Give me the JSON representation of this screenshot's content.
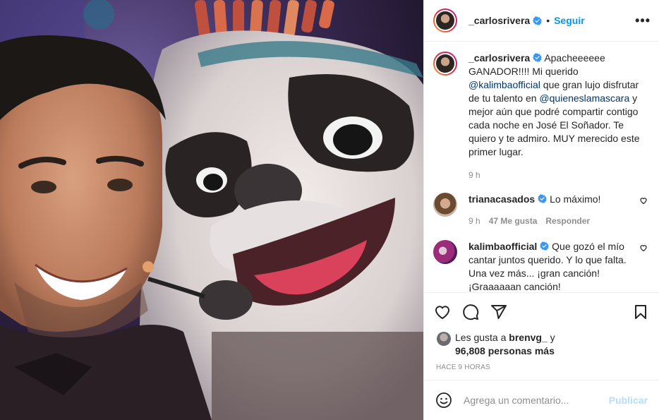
{
  "post": {
    "author": "_carlosrivera",
    "follow_label": "Seguir",
    "separator": "•",
    "caption_prefix": "Apacheeeeee GANADOR!!!! Mi querido ",
    "caption_mention1": "@kalimbaofficial",
    "caption_middle": " que gran lujo disfrutar de tu talento en ",
    "caption_mention2": "@quieneslamascara",
    "caption_suffix": " y mejor aún que podré compartir contigo cada noche en José El Soñador. Te quiero y te admiro. MUY merecido este primer lugar.",
    "caption_time": "9 h"
  },
  "comments": [
    {
      "user": "trianacasados",
      "text": "Lo máximo!",
      "time": "9 h",
      "likes": "47 Me gusta",
      "reply": "Responder"
    },
    {
      "user": "kalimbaofficial",
      "text": "Que gozó el mío cantar juntos querido. Y lo que falta. Una vez más... ¡gran canción! ¡Graaaaaan canción!"
    }
  ],
  "likes": {
    "prefix": "Les gusta a ",
    "user": "brenvg_",
    "middle": " y",
    "count": "96,808 personas más"
  },
  "time_ago": "HACE 9 HORAS",
  "add_comment": {
    "placeholder": "Agrega un comentario...",
    "publish": "Publicar"
  },
  "colors": {
    "accent": "#0095f6",
    "publish_disabled": "#b2dffc",
    "verified": "#3897f0"
  }
}
